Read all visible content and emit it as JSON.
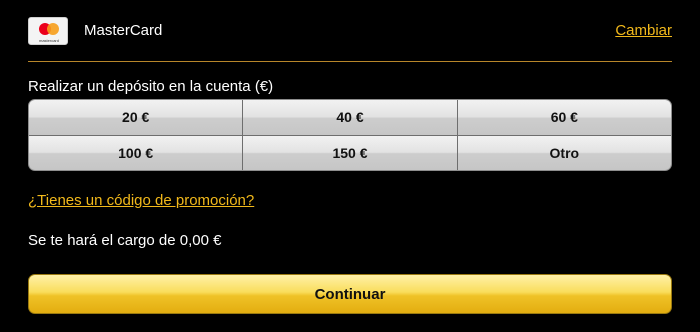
{
  "payment": {
    "card_logo_text": "mastercard",
    "card_name": "MasterCard",
    "change_label": "Cambiar"
  },
  "deposit": {
    "label": "Realizar un depósito en la cuenta (€)",
    "amounts": [
      "20 €",
      "40 €",
      "60 €",
      "100 €",
      "150 €",
      "Otro"
    ]
  },
  "promo": {
    "label": "¿Tienes un código de promoción?"
  },
  "charge": {
    "text": "Se te hará el cargo de 0,00 €"
  },
  "actions": {
    "continue_label": "Continuar"
  },
  "colors": {
    "accent": "#f2b91b",
    "background": "#000000",
    "button_yellow": "#efc227"
  }
}
